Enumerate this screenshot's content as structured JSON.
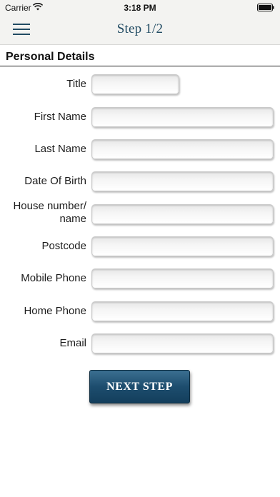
{
  "status_bar": {
    "carrier": "Carrier",
    "time": "3:18 PM"
  },
  "nav": {
    "title": "Step 1/2",
    "menu_icon": "hamburger-menu-icon"
  },
  "section": {
    "title": "Personal Details"
  },
  "form": {
    "fields": [
      {
        "label": "Title",
        "value": ""
      },
      {
        "label": "First Name",
        "value": ""
      },
      {
        "label": "Last Name",
        "value": ""
      },
      {
        "label": "Date Of Birth",
        "value": ""
      },
      {
        "label": "House number/ name",
        "value": ""
      },
      {
        "label": "Postcode",
        "value": ""
      },
      {
        "label": "Mobile Phone",
        "value": ""
      },
      {
        "label": "Home Phone",
        "value": ""
      },
      {
        "label": "Email",
        "value": ""
      }
    ]
  },
  "actions": {
    "next_label": "NEXT STEP"
  },
  "colors": {
    "nav_title": "#214b63",
    "button_bg": "#1d4d6e",
    "bar_bg": "#f3f3f1"
  }
}
